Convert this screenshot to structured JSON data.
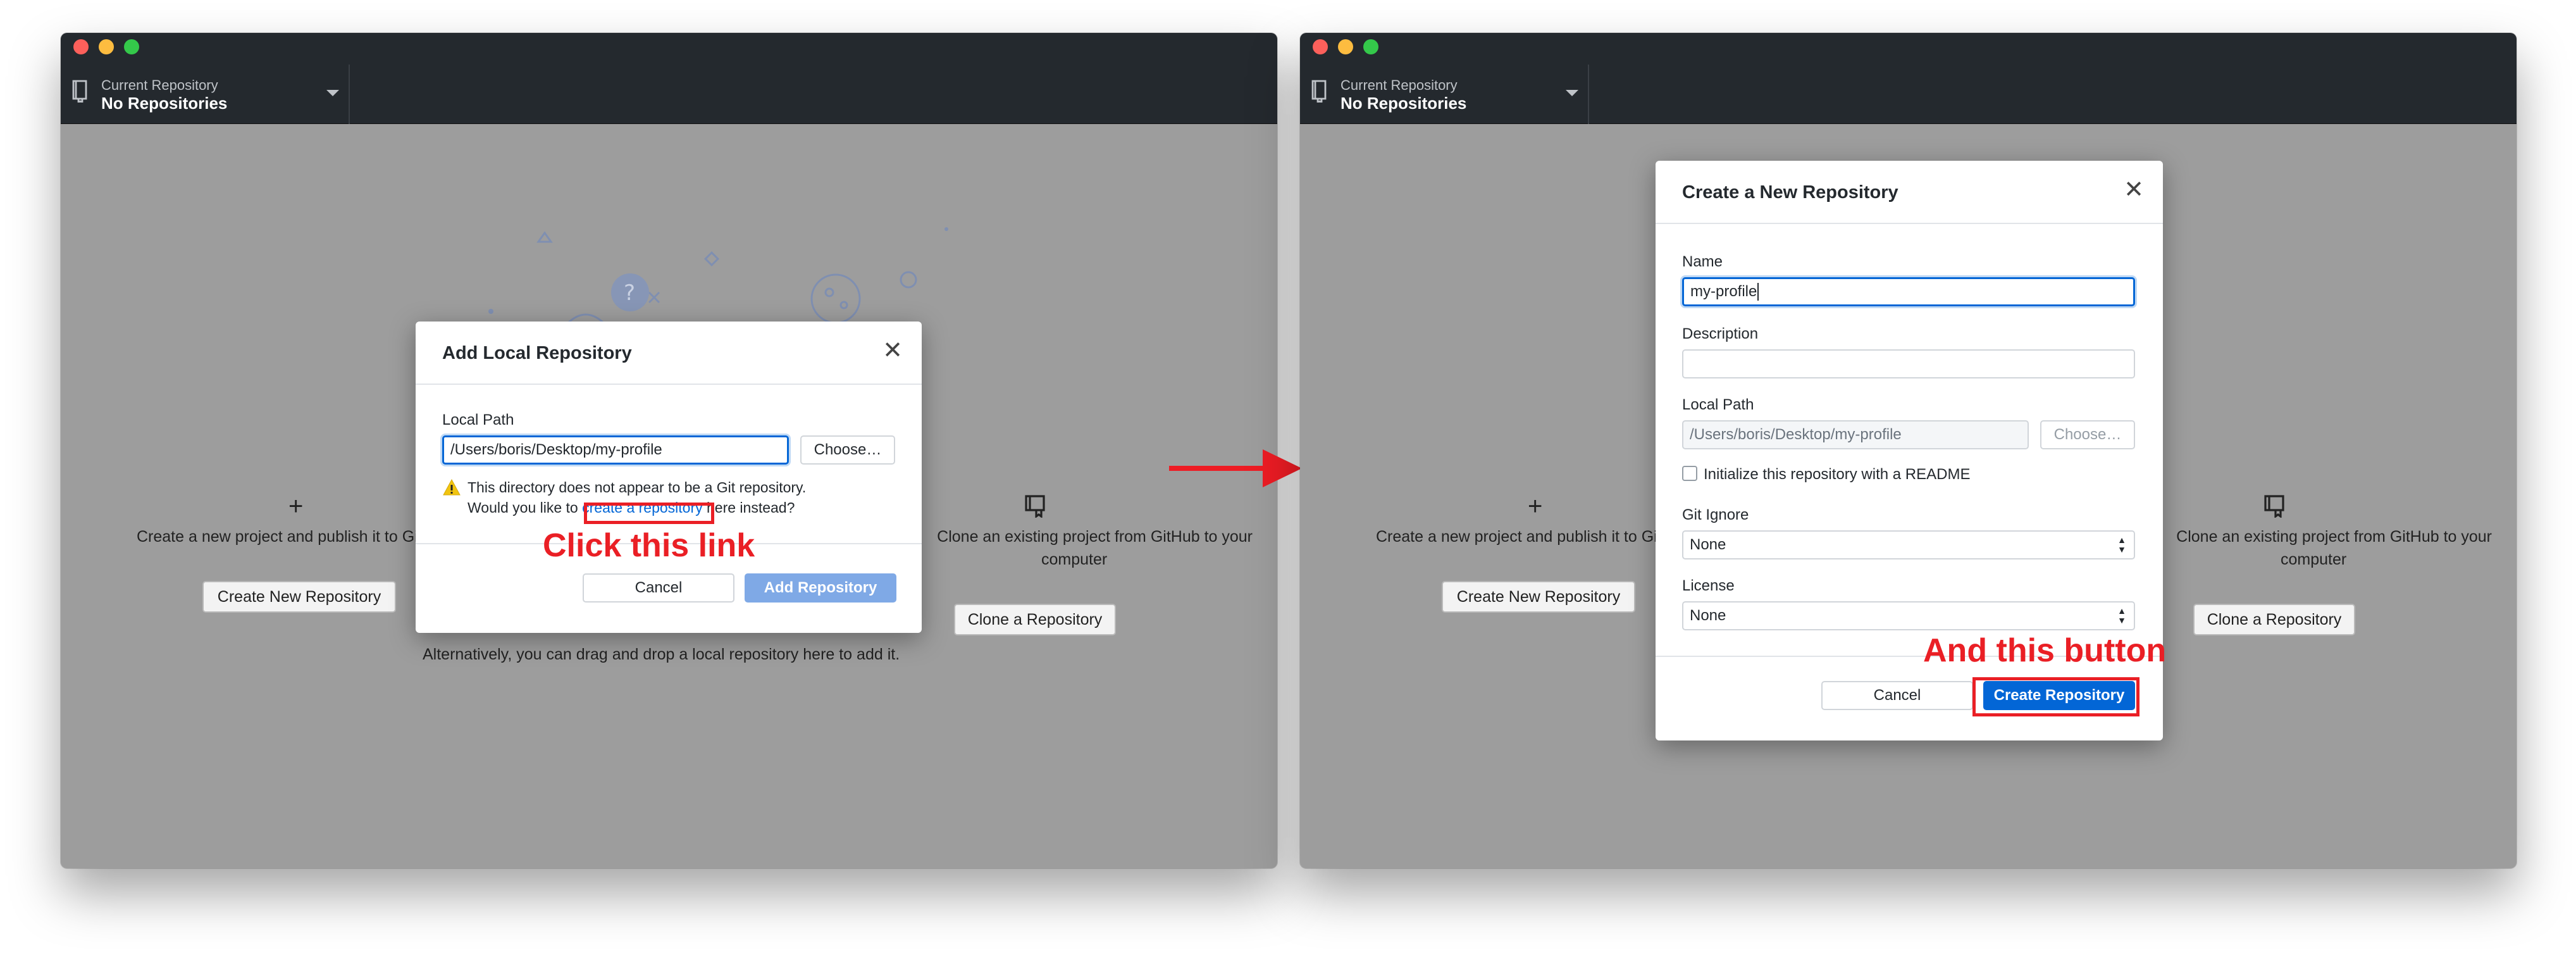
{
  "left_window": {
    "toolbar": {
      "small_label": "Current Repository",
      "repo_name": "No Repositories"
    },
    "background": {
      "create_text": "Create a new project and publish it to GitHub",
      "create_button": "Create New Repository",
      "clone_text_line1": "Clone an existing project from GitHub to your",
      "clone_text_line2": "computer",
      "clone_button": "Clone a Repository",
      "drag_text": "Alternatively, you can drag and drop a local repository here to add it."
    },
    "dialog": {
      "title": "Add Local Repository",
      "close_glyph": "✕",
      "local_path_label": "Local Path",
      "local_path_value": "/Users/boris/Desktop/my-profile",
      "choose_button": "Choose…",
      "warning_line1": "This directory does not appear to be a Git repository.",
      "warning_prefix": "Would you like to ",
      "warning_link": "create a repository",
      "warning_suffix": " here instead?",
      "cancel_button": "Cancel",
      "add_button": "Add Repository"
    }
  },
  "right_window": {
    "toolbar": {
      "small_label": "Current Repository",
      "repo_name": "No Repositories"
    },
    "background": {
      "create_text": "Create a new project and publish it to GitHub",
      "create_button": "Create New Repository",
      "clone_text_line1": "Clone an existing project from GitHub to your",
      "clone_text_line2": "computer",
      "clone_button": "Clone a Repository"
    },
    "dialog": {
      "title": "Create a New Repository",
      "close_glyph": "✕",
      "name_label": "Name",
      "name_value": "my-profile",
      "description_label": "Description",
      "description_value": "",
      "local_path_label": "Local Path",
      "local_path_value": "/Users/boris/Desktop/my-profile",
      "choose_button": "Choose…",
      "readme_label": "Initialize this repository with a README",
      "gitignore_label": "Git Ignore",
      "gitignore_value": "None",
      "license_label": "License",
      "license_value": "None",
      "cancel_button": "Cancel",
      "create_button": "Create Repository"
    }
  },
  "annotations": {
    "left_callout": "Click this link",
    "right_callout": "And this button",
    "color": "#ea1f25"
  }
}
